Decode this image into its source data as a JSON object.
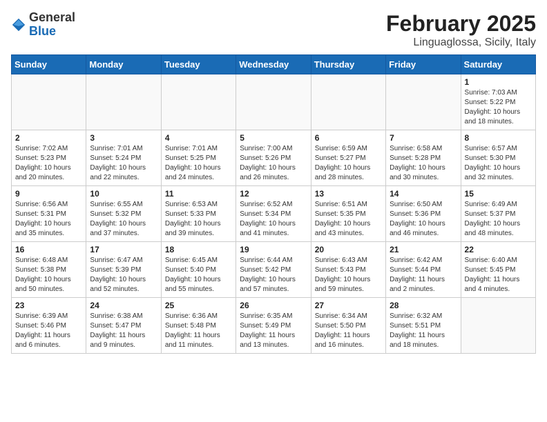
{
  "header": {
    "logo_general": "General",
    "logo_blue": "Blue",
    "month_year": "February 2025",
    "location": "Linguaglossa, Sicily, Italy"
  },
  "weekdays": [
    "Sunday",
    "Monday",
    "Tuesday",
    "Wednesday",
    "Thursday",
    "Friday",
    "Saturday"
  ],
  "weeks": [
    [
      {
        "day": "",
        "info": ""
      },
      {
        "day": "",
        "info": ""
      },
      {
        "day": "",
        "info": ""
      },
      {
        "day": "",
        "info": ""
      },
      {
        "day": "",
        "info": ""
      },
      {
        "day": "",
        "info": ""
      },
      {
        "day": "1",
        "info": "Sunrise: 7:03 AM\nSunset: 5:22 PM\nDaylight: 10 hours and 18 minutes."
      }
    ],
    [
      {
        "day": "2",
        "info": "Sunrise: 7:02 AM\nSunset: 5:23 PM\nDaylight: 10 hours and 20 minutes."
      },
      {
        "day": "3",
        "info": "Sunrise: 7:01 AM\nSunset: 5:24 PM\nDaylight: 10 hours and 22 minutes."
      },
      {
        "day": "4",
        "info": "Sunrise: 7:01 AM\nSunset: 5:25 PM\nDaylight: 10 hours and 24 minutes."
      },
      {
        "day": "5",
        "info": "Sunrise: 7:00 AM\nSunset: 5:26 PM\nDaylight: 10 hours and 26 minutes."
      },
      {
        "day": "6",
        "info": "Sunrise: 6:59 AM\nSunset: 5:27 PM\nDaylight: 10 hours and 28 minutes."
      },
      {
        "day": "7",
        "info": "Sunrise: 6:58 AM\nSunset: 5:28 PM\nDaylight: 10 hours and 30 minutes."
      },
      {
        "day": "8",
        "info": "Sunrise: 6:57 AM\nSunset: 5:30 PM\nDaylight: 10 hours and 32 minutes."
      }
    ],
    [
      {
        "day": "9",
        "info": "Sunrise: 6:56 AM\nSunset: 5:31 PM\nDaylight: 10 hours and 35 minutes."
      },
      {
        "day": "10",
        "info": "Sunrise: 6:55 AM\nSunset: 5:32 PM\nDaylight: 10 hours and 37 minutes."
      },
      {
        "day": "11",
        "info": "Sunrise: 6:53 AM\nSunset: 5:33 PM\nDaylight: 10 hours and 39 minutes."
      },
      {
        "day": "12",
        "info": "Sunrise: 6:52 AM\nSunset: 5:34 PM\nDaylight: 10 hours and 41 minutes."
      },
      {
        "day": "13",
        "info": "Sunrise: 6:51 AM\nSunset: 5:35 PM\nDaylight: 10 hours and 43 minutes."
      },
      {
        "day": "14",
        "info": "Sunrise: 6:50 AM\nSunset: 5:36 PM\nDaylight: 10 hours and 46 minutes."
      },
      {
        "day": "15",
        "info": "Sunrise: 6:49 AM\nSunset: 5:37 PM\nDaylight: 10 hours and 48 minutes."
      }
    ],
    [
      {
        "day": "16",
        "info": "Sunrise: 6:48 AM\nSunset: 5:38 PM\nDaylight: 10 hours and 50 minutes."
      },
      {
        "day": "17",
        "info": "Sunrise: 6:47 AM\nSunset: 5:39 PM\nDaylight: 10 hours and 52 minutes."
      },
      {
        "day": "18",
        "info": "Sunrise: 6:45 AM\nSunset: 5:40 PM\nDaylight: 10 hours and 55 minutes."
      },
      {
        "day": "19",
        "info": "Sunrise: 6:44 AM\nSunset: 5:42 PM\nDaylight: 10 hours and 57 minutes."
      },
      {
        "day": "20",
        "info": "Sunrise: 6:43 AM\nSunset: 5:43 PM\nDaylight: 10 hours and 59 minutes."
      },
      {
        "day": "21",
        "info": "Sunrise: 6:42 AM\nSunset: 5:44 PM\nDaylight: 11 hours and 2 minutes."
      },
      {
        "day": "22",
        "info": "Sunrise: 6:40 AM\nSunset: 5:45 PM\nDaylight: 11 hours and 4 minutes."
      }
    ],
    [
      {
        "day": "23",
        "info": "Sunrise: 6:39 AM\nSunset: 5:46 PM\nDaylight: 11 hours and 6 minutes."
      },
      {
        "day": "24",
        "info": "Sunrise: 6:38 AM\nSunset: 5:47 PM\nDaylight: 11 hours and 9 minutes."
      },
      {
        "day": "25",
        "info": "Sunrise: 6:36 AM\nSunset: 5:48 PM\nDaylight: 11 hours and 11 minutes."
      },
      {
        "day": "26",
        "info": "Sunrise: 6:35 AM\nSunset: 5:49 PM\nDaylight: 11 hours and 13 minutes."
      },
      {
        "day": "27",
        "info": "Sunrise: 6:34 AM\nSunset: 5:50 PM\nDaylight: 11 hours and 16 minutes."
      },
      {
        "day": "28",
        "info": "Sunrise: 6:32 AM\nSunset: 5:51 PM\nDaylight: 11 hours and 18 minutes."
      },
      {
        "day": "",
        "info": ""
      }
    ]
  ]
}
